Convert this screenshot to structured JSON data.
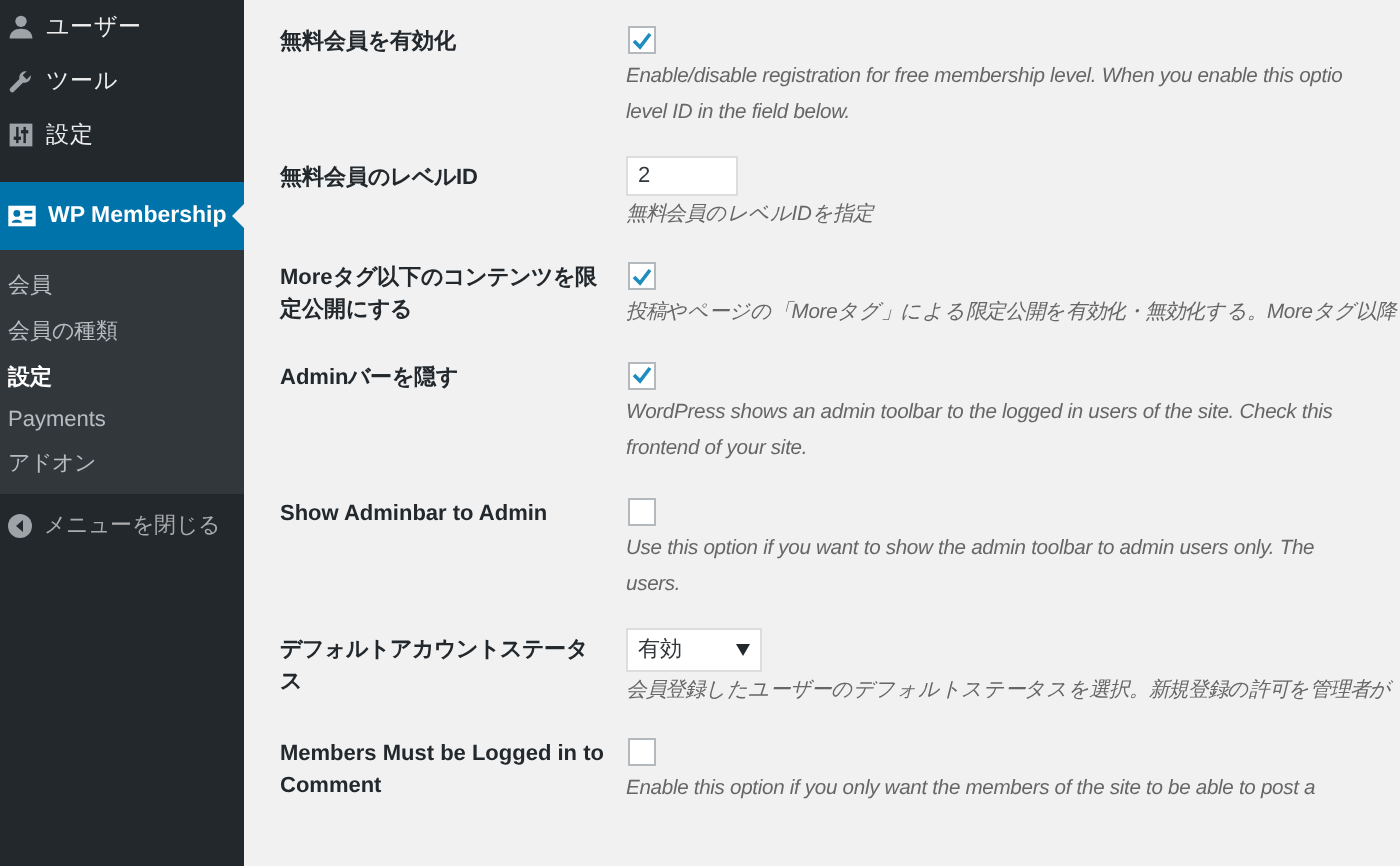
{
  "sidebar": {
    "items": [
      {
        "label": "ユーザー",
        "selected": false
      },
      {
        "label": "ツール",
        "selected": false
      },
      {
        "label": "設定",
        "selected": false
      },
      {
        "label": "WP Membership",
        "selected": true,
        "children": [
          {
            "label": "会員",
            "selected": false
          },
          {
            "label": "会員の種類",
            "selected": false
          },
          {
            "label": "設定",
            "selected": true
          },
          {
            "label": "Payments",
            "selected": false
          },
          {
            "label": "アドオン",
            "selected": false
          }
        ]
      }
    ],
    "collapse": "メニューを閉じる"
  },
  "settings": [
    {
      "label": "無料会員を有効化",
      "kind": "checkbox",
      "checked": true,
      "description": [
        "Enable/disable registration for free membership level. When you enable this optio",
        "level ID in the field below."
      ]
    },
    {
      "label": "無料会員のレベルID",
      "kind": "text",
      "value": "2",
      "description": [
        "無料会員のレベルIDを指定"
      ]
    },
    {
      "label": "Moreタグ以下のコンテンツを限定公開にする",
      "kind": "checkbox",
      "checked": true,
      "description": [
        "投稿やページの「Moreタグ」による限定公開を有効化・無効化する。Moreタグ以降"
      ]
    },
    {
      "label": "Adminバーを隠す",
      "kind": "checkbox",
      "checked": true,
      "description": [
        "WordPress shows an admin toolbar to the logged in users of the site. Check this",
        "frontend of your site."
      ]
    },
    {
      "label": "Show Adminbar to Admin",
      "kind": "checkbox",
      "checked": false,
      "description": [
        "Use this option if you want to show the admin toolbar to admin users only. The",
        "users."
      ]
    },
    {
      "label": "デフォルトアカウントステータス",
      "kind": "select",
      "value": "有効",
      "description": [
        "会員登録したユーザーのデフォルトステータスを選択。新規登録の許可を管理者が"
      ]
    },
    {
      "label": "Members Must be Logged in to Comment",
      "kind": "checkbox",
      "checked": false,
      "description": [
        "Enable this option if you only want the members of the site to be able to post a"
      ]
    }
  ]
}
